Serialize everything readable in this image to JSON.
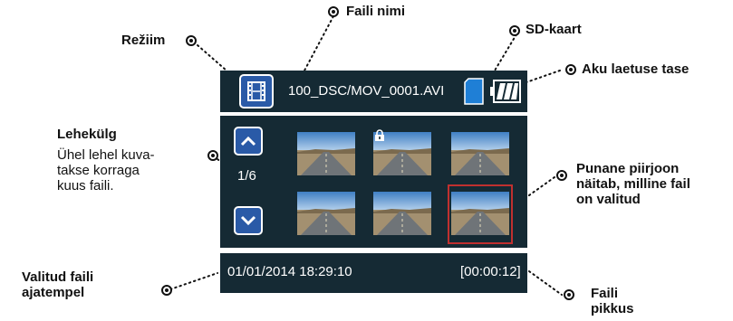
{
  "screen": {
    "file_name": "100_DSC/MOV_0001.AVI",
    "page_indicator": "1/6",
    "timestamp": "01/01/2014 18:29:10",
    "duration": "[00:00:12]",
    "mode_icon": "film-icon",
    "storage_icon": "sd-card-icon",
    "battery_icon": "battery-icon",
    "lock_icon": "lock-icon",
    "thumbnail_count": 6,
    "selected_thumbnail_index": 5
  },
  "callouts": {
    "mode": "Režiim",
    "file_name": "Faili nimi",
    "sd_card": "SD-kaart",
    "battery_level": "Aku laetuse tase",
    "page_title": "Lehekülg",
    "page_desc_1": "Ühel lehel kuva-",
    "page_desc_2": "takse korraga",
    "page_desc_3": "kuus faili.",
    "red_frame_1": "Punane piirjoon",
    "red_frame_2": "näitab, milline fail",
    "red_frame_3": "on valitud",
    "timestamp_1": "Valitud faili",
    "timestamp_2": "ajatempel",
    "length_1": "Faili",
    "length_2": "pikkus"
  },
  "colors": {
    "panel_bg": "#152a34",
    "button_blue": "#2a5aa7",
    "selection_red": "#c0302f",
    "sd_blue": "#1f7fd6"
  }
}
